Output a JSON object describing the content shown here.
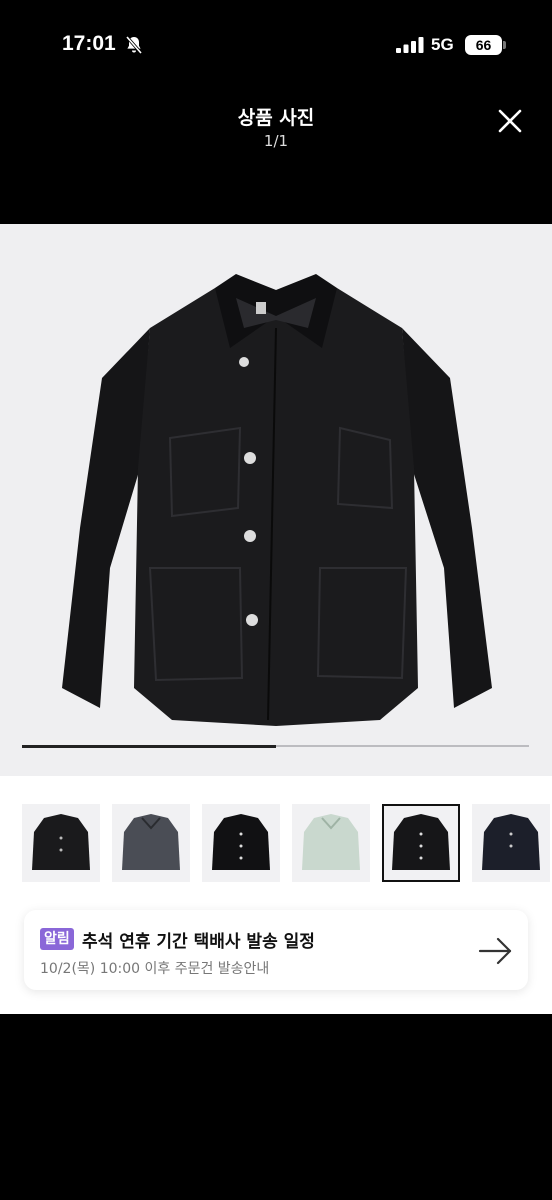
{
  "status_bar": {
    "time": "17:01",
    "network": "5G",
    "battery": "66"
  },
  "header": {
    "title": "상품 사진",
    "counter": "1/1"
  },
  "gallery": {
    "progress": 0.5
  },
  "notice": {
    "badge": "알림",
    "title": "추석 연휴 기간 택배사 발송 일정",
    "subtitle": "10/2(목) 10:00 이후 주문건 발송안내"
  },
  "colors": {
    "badge": "#8a67d8",
    "background": "#000000",
    "photo_bg": "#efeff1"
  }
}
